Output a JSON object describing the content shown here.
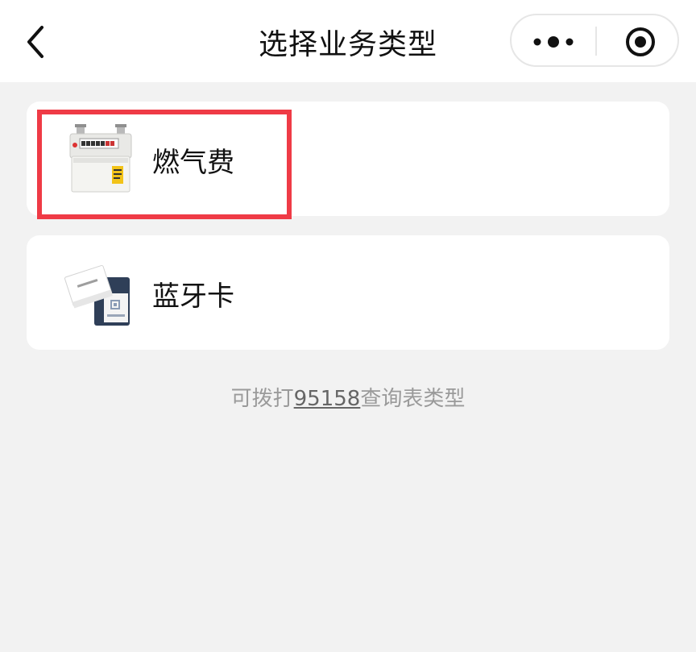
{
  "header": {
    "title": "选择业务类型"
  },
  "items": [
    {
      "label": "燃气费",
      "icon": "gas-meter-icon"
    },
    {
      "label": "蓝牙卡",
      "icon": "bluetooth-card-icon"
    }
  ],
  "hint": {
    "prefix": "可拨打",
    "phone": "95158",
    "suffix": "查询表类型"
  },
  "colors": {
    "highlight_border": "#ef3b46",
    "background": "#f2f2f2",
    "card": "#ffffff",
    "hint_text": "#9a9a9a"
  }
}
